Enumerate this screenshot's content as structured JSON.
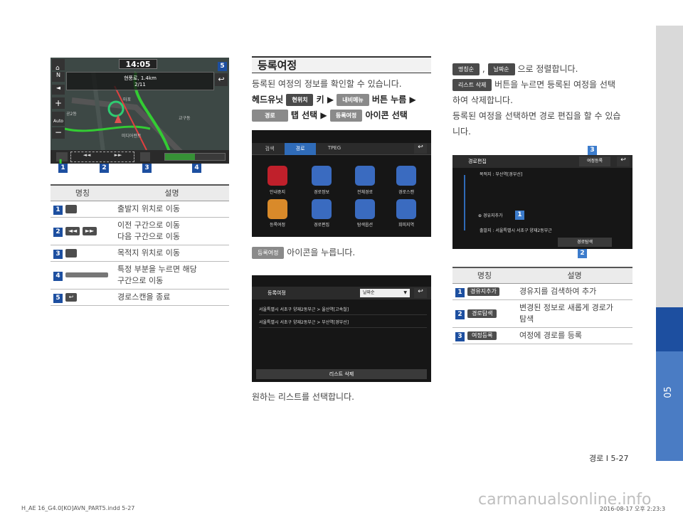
{
  "colors": {
    "accent": "#1d4fa0",
    "side_active": "#1d4fa0",
    "side_gray": "#d9d9d9",
    "map_green": "#33cc33"
  },
  "left_screen": {
    "time": "14:05",
    "road": "현풍로, 1.4km",
    "count": "2/11",
    "side_buttons": [
      "N",
      "Auto"
    ],
    "callouts": [
      "1",
      "2",
      "3",
      "4",
      "5"
    ],
    "map_labels": [
      "공2동",
      "마포",
      "미디어렌트",
      "교구동"
    ]
  },
  "left_table": {
    "headers": [
      "명칭",
      "설명"
    ],
    "rows": [
      {
        "num": "1",
        "desc": "출발지 위치로 이동"
      },
      {
        "num": "2",
        "desc": "이전 구간으로 이동\n다음 구간으로 이동"
      },
      {
        "num": "3",
        "desc": "목적지 위치로 이동"
      },
      {
        "num": "4",
        "desc": "특정 부분을 누르면 해당\n구간으로 이동"
      },
      {
        "num": "5",
        "desc": "경로스캔을 종료"
      }
    ]
  },
  "mid": {
    "heading": "등록여정",
    "intro": "등록된 여정의 정보를 확인할 수 있습니다.",
    "step1_prefix": "헤드유닛",
    "btn_current": "현위치",
    "step1_key": "키 ▶",
    "btn_navmenu": "내비메뉴",
    "step1_button": "버튼 누름 ▶",
    "btn_route": "경로",
    "step2_tab": "탭 선택 ▶",
    "btn_trip": "등록여정",
    "step2_icon": "아이콘 선택",
    "menu": {
      "tabs": [
        "검색",
        "경로",
        "TPEG"
      ],
      "icons": [
        {
          "label": "안내중지",
          "color": "#c0202b"
        },
        {
          "label": "경로정보",
          "color": "#3a6bc0"
        },
        {
          "label": "전체경로",
          "color": "#3a6bc0"
        },
        {
          "label": "경로스캔",
          "color": "#3a6bc0"
        },
        {
          "label": "등록여정",
          "color": "#d98a2a"
        },
        {
          "label": "경로편집",
          "color": "#3a6bc0"
        },
        {
          "label": "탐색옵션",
          "color": "#3a6bc0"
        },
        {
          "label": "회피지역",
          "color": "#3a6bc0"
        }
      ]
    },
    "press_tail": "아이콘을 누릅니다.",
    "trip_screen": {
      "title": "등록여정",
      "sort": "날짜순",
      "items": [
        "서울특별시 서초구 양재2동부근 > 울산역[고속철]",
        "서울특별시 서초구 양재2동부근 > 부산역[경부선]"
      ],
      "delete": "리스트 삭제"
    },
    "choose": "원하는 리스트를 선택합니다."
  },
  "right": {
    "btn_name_sort": "명칭순",
    "comma": ",",
    "btn_date_sort": "날짜순",
    "sort_tail": "으로 정렬합니다.",
    "btn_list_delete": "리스트 삭제",
    "delete_line1": "버튼을 누르면 등록된 여정을 선택",
    "delete_line2": "하여 삭제합니다.",
    "edit_line1": "등록된 여정을 선택하면 경로 편집을 할 수 있습",
    "edit_line2": "니다.",
    "edit_screen": {
      "title": "경로편집",
      "register": "여정등록",
      "dest": "목적지 : 부산역[경부선]",
      "add": "경유지추가",
      "start": "출발지 : 서울특별시 서초구 양재2동부근",
      "search": "경로탐색",
      "callouts": [
        "1",
        "2",
        "3"
      ]
    },
    "table": {
      "headers": [
        "명칭",
        "설명"
      ],
      "rows": [
        {
          "num": "1",
          "btn": "경유지추가",
          "desc": "경유지를 검색하여 추가"
        },
        {
          "num": "2",
          "btn": "경로탐색",
          "desc": "변경된 정보로 새롭게 경로가\n탐색"
        },
        {
          "num": "3",
          "btn": "여정등록",
          "desc": "여정에 경로를 등록"
        }
      ]
    }
  },
  "footer": {
    "page": "경로 I 5-27",
    "file": "H_AE 16_G4.0[KO]AVN_PART5.indd   5-27",
    "date": "2016-08-17   오후 2:23:3",
    "watermark": "carmanualsonline.info",
    "chapter": "05"
  }
}
